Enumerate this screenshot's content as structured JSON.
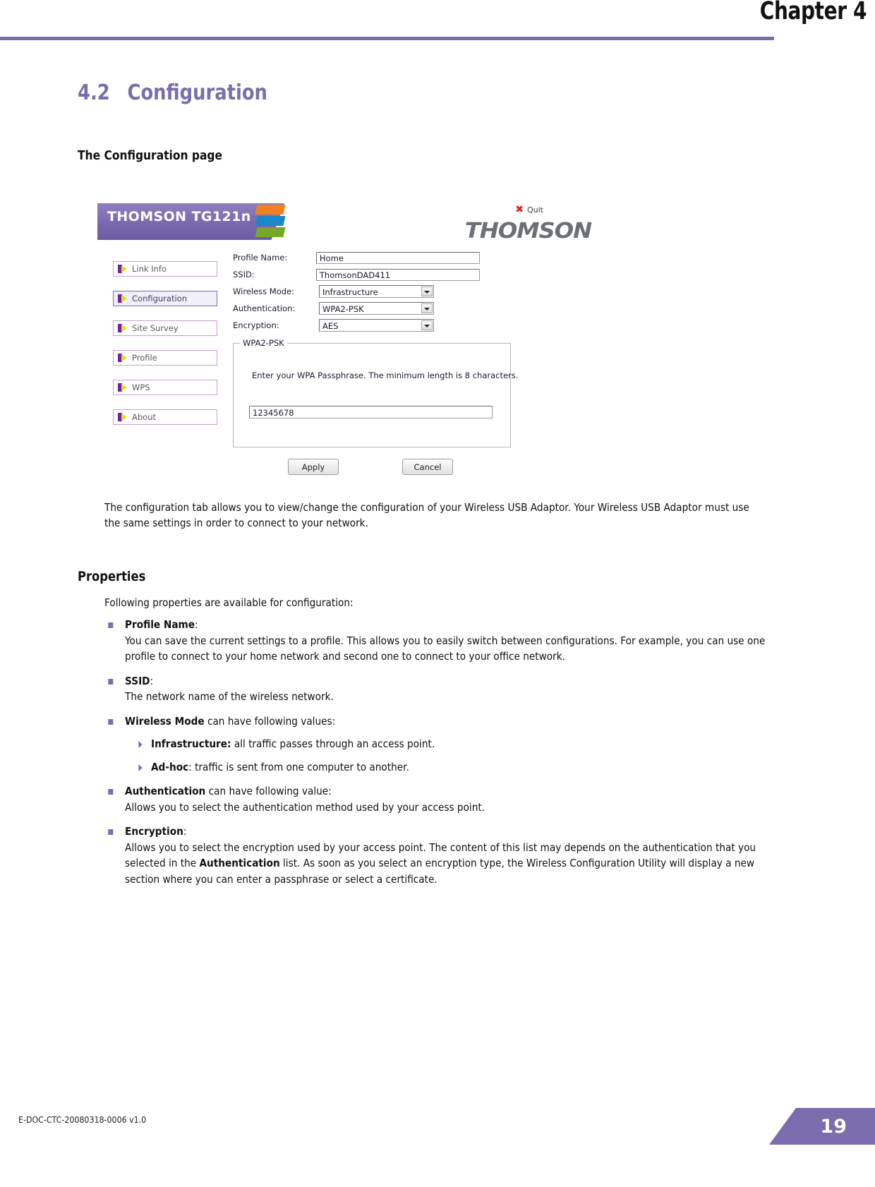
{
  "header": {
    "chapter": "Chapter 4",
    "accent_color": "#7b6cad"
  },
  "section": {
    "number": "4.2",
    "title": "Configuration",
    "subheading": "The Configuration page"
  },
  "app_screenshot": {
    "brand_banner": "THOMSON TG121n",
    "quit_label": "Quit",
    "quit_icon": "close-x-icon",
    "logo_text": "THOMSON",
    "nav_items": [
      {
        "label": "Link Info",
        "active": false
      },
      {
        "label": "Configuration",
        "active": true
      },
      {
        "label": "Site Survey",
        "active": false
      },
      {
        "label": "Profile",
        "active": false
      },
      {
        "label": "WPS",
        "active": false
      },
      {
        "label": "About",
        "active": false
      }
    ],
    "fields": [
      {
        "label": "Profile Name:",
        "value": "Home",
        "type": "text"
      },
      {
        "label": "SSID:",
        "value": "ThomsonDAD411",
        "type": "text"
      },
      {
        "label": "Wireless Mode:",
        "value": "Infrastructure",
        "type": "select"
      },
      {
        "label": "Authentication:",
        "value": "WPA2-PSK",
        "type": "select"
      },
      {
        "label": "Encryption:",
        "value": "AES",
        "type": "select"
      }
    ],
    "psk_group": {
      "legend": "WPA2-PSK",
      "help_text": "Enter your WPA Passphrase.  The minimum length is 8 characters.",
      "passphrase_value": "12345678"
    },
    "buttons": {
      "apply": "Apply",
      "cancel": "Cancel"
    }
  },
  "body": {
    "intro_paragraph": "The configuration tab allows you to view/change the configuration of your Wireless USB Adaptor. Your Wireless USB Adaptor must use the same settings in order to connect to your network.",
    "properties_heading": "Properties",
    "properties_intro": "Following properties are available for configuration:",
    "bullets": [
      {
        "term": "Profile Name",
        "term_suffix": ":",
        "text": "You can save the current settings to a profile. This allows you to easily switch between configurations. For example, you can use one profile to connect to your home network and second one to connect to your office network."
      },
      {
        "term": "SSID",
        "term_suffix": ":",
        "text": "The network name of the wireless network."
      },
      {
        "term": "Wireless Mode",
        "term_suffix": " can have following values:",
        "text": "",
        "sub_bullets": [
          {
            "term": "Infrastructure:",
            "text": " all traffic passes through an access point."
          },
          {
            "term": "Ad-hoc",
            "text": ": traffic is sent from one computer to another."
          }
        ]
      },
      {
        "term": "Authentication",
        "term_suffix": " can have following value:",
        "text": "Allows you to select the authentication method used by your access point."
      },
      {
        "term": "Encryption",
        "term_suffix": ":",
        "text_pre": "Allows you to select the encryption used by your access point. The content of this list may depends on the authentication that you selected in the ",
        "text_bold": "Authentication",
        "text_post": " list. As soon as you select an encryption type, the Wireless Configuration Utility will display a new section where you can enter a passphrase or select a certificate."
      }
    ]
  },
  "footer": {
    "doc_id": "E-DOC-CTC-20080318-0006 v1.0",
    "page_number": "19"
  }
}
